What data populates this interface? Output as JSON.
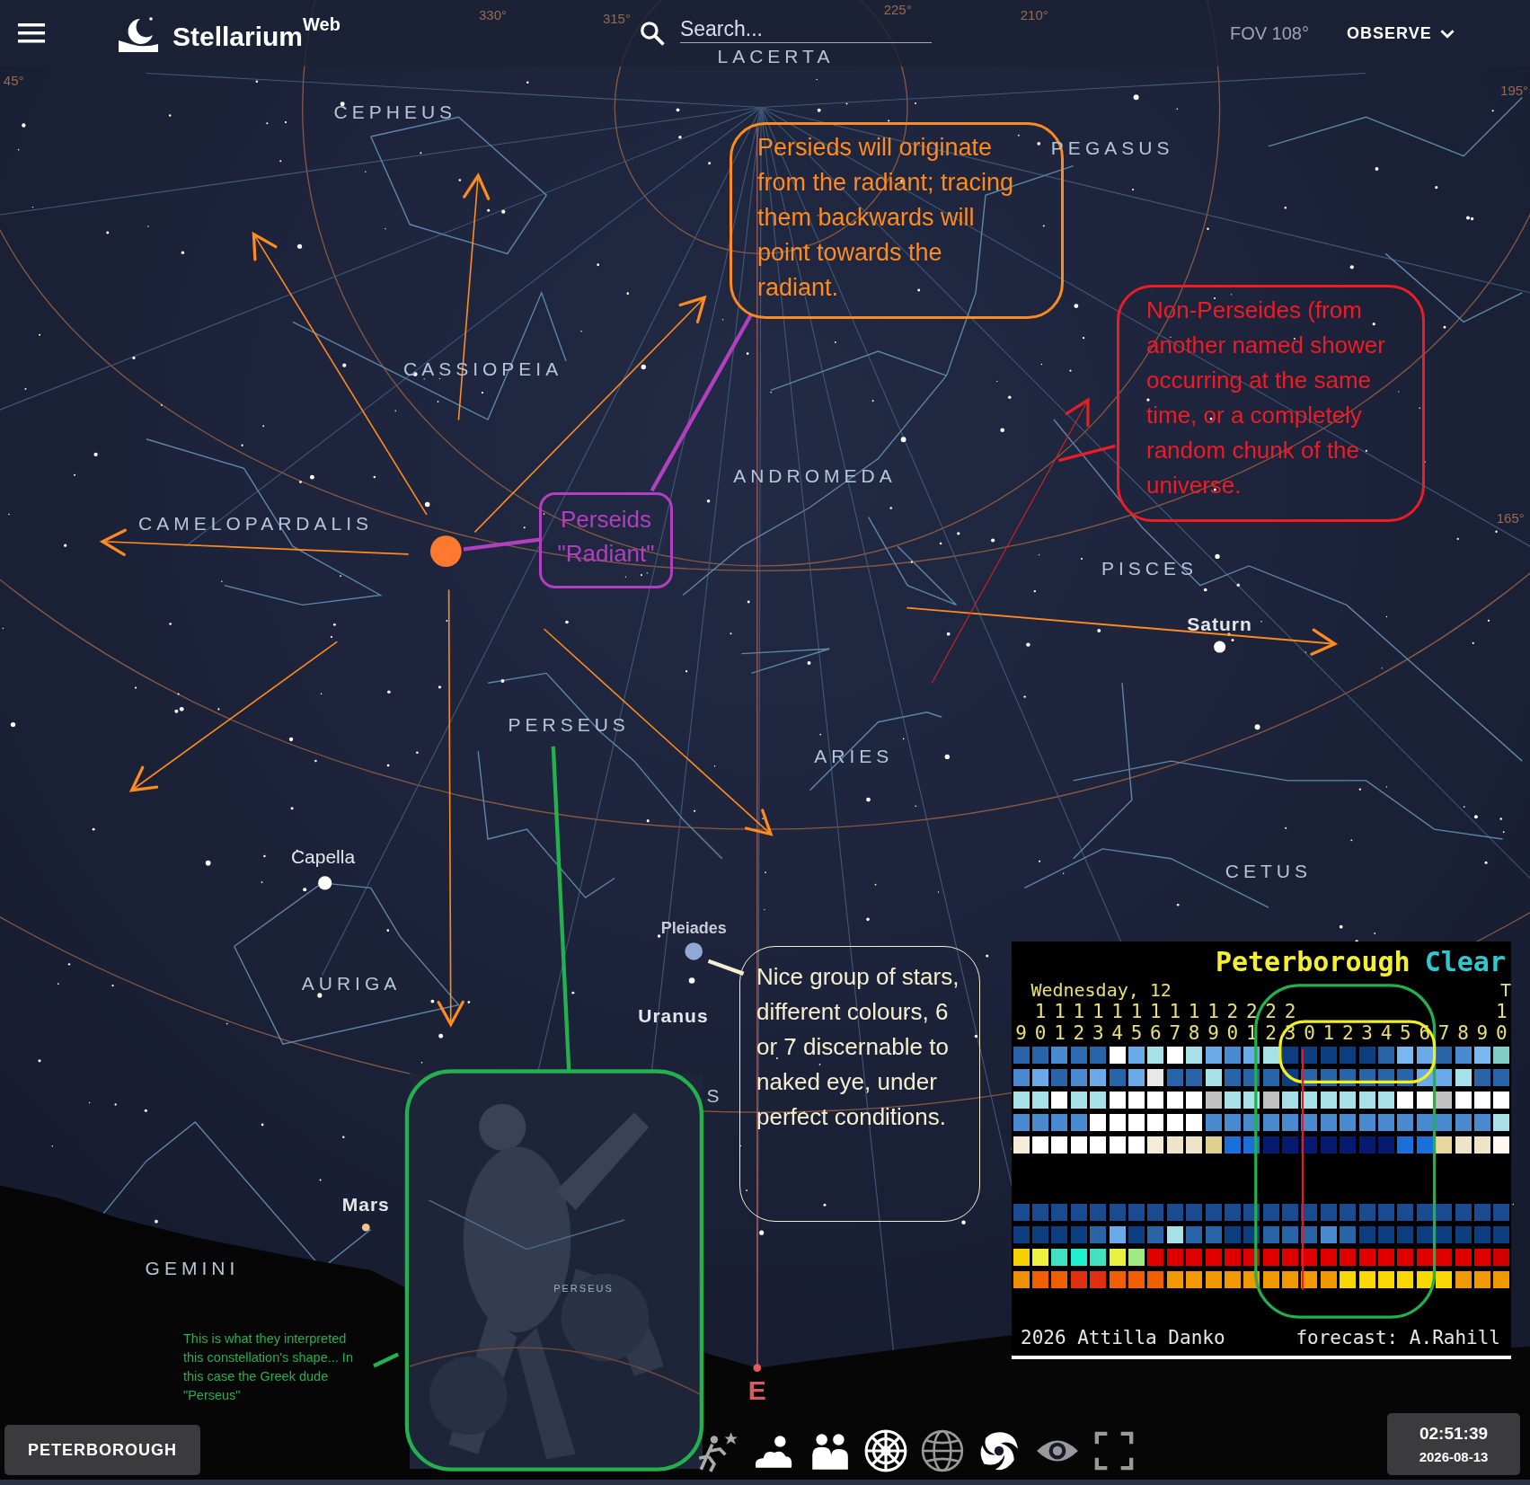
{
  "top_bar": {
    "title": "Stellarium",
    "title_suffix": "Web",
    "search": {
      "placeholder": "Search..."
    },
    "fov": "FOV 108°",
    "observe_menu": "OBSERVE"
  },
  "sky_labels": [
    {
      "text": "LACERTA",
      "kind": "constellation"
    },
    {
      "text": "CEPHEUS",
      "kind": "constellation"
    },
    {
      "text": "PEGASUS",
      "kind": "constellation"
    },
    {
      "text": "CASSIOPEIA",
      "kind": "constellation"
    },
    {
      "text": "ANDROMEDA",
      "kind": "constellation"
    },
    {
      "text": "CAMELOPARDALIS",
      "kind": "constellation"
    },
    {
      "text": "PISCES",
      "kind": "constellation"
    },
    {
      "text": "Saturn",
      "kind": "planet"
    },
    {
      "text": "PERSEUS",
      "kind": "constellation"
    },
    {
      "text": "ARIES",
      "kind": "constellation"
    },
    {
      "text": "Capella",
      "kind": "star"
    },
    {
      "text": "CETUS",
      "kind": "constellation"
    },
    {
      "text": "Pleiades",
      "kind": "cluster"
    },
    {
      "text": "AURIGA",
      "kind": "constellation"
    },
    {
      "text": "Uranus",
      "kind": "planet"
    },
    {
      "text": "S",
      "kind": "constellation"
    },
    {
      "text": "Mars",
      "kind": "planet"
    },
    {
      "text": "GEMINI",
      "kind": "constellation"
    },
    {
      "text": "PERSEUS",
      "kind": "art"
    },
    {
      "text": "E",
      "kind": "cardinal"
    },
    {
      "text": "330°",
      "kind": "grid"
    },
    {
      "text": "315°",
      "kind": "grid"
    },
    {
      "text": "225°",
      "kind": "grid"
    },
    {
      "text": "210°",
      "kind": "grid"
    },
    {
      "text": "45°",
      "kind": "grid"
    },
    {
      "text": "195°",
      "kind": "grid"
    },
    {
      "text": "165°",
      "kind": "grid"
    }
  ],
  "annotations": [
    {
      "kind": "box",
      "color": "#ff8a1e",
      "text": "Persieds will originate from the radiant; tracing them backwards will point towards the radiant."
    },
    {
      "kind": "box",
      "color": "#b13fc0",
      "text": "Perseids \"Radiant\""
    },
    {
      "kind": "box",
      "color": "#ee1c24",
      "text": "Non-Perseides (from another named shower occurring at the same time, or a completely random chunk of the universe."
    },
    {
      "kind": "box",
      "color": "#f5efd0",
      "text": "Nice group of stars, different colours, 6 or 7 discernable to naked eye, under perfect conditions."
    },
    {
      "kind": "note",
      "color": "#22b14c",
      "text": "This is what they interpreted this constellation's shape... In this case the Greek dude \"Perseus\""
    }
  ],
  "clear_sky_chart": {
    "location": "Peterborough",
    "condition": "Clear",
    "day": "Wednesday, 12",
    "next_day": "T",
    "hours": [
      {
        "ones": "9"
      },
      {
        "tens": "1",
        "ones": "0"
      },
      {
        "tens": "1",
        "ones": "1"
      },
      {
        "tens": "1",
        "ones": "2"
      },
      {
        "tens": "1",
        "ones": "3"
      },
      {
        "tens": "1",
        "ones": "4"
      },
      {
        "tens": "1",
        "ones": "5"
      },
      {
        "tens": "1",
        "ones": "6"
      },
      {
        "tens": "1",
        "ones": "7"
      },
      {
        "tens": "1",
        "ones": "8"
      },
      {
        "tens": "1",
        "ones": "9"
      },
      {
        "tens": "2",
        "ones": "0"
      },
      {
        "tens": "2",
        "ones": "1"
      },
      {
        "tens": "2",
        "ones": "2"
      },
      {
        "tens": "2",
        "ones": "3"
      },
      {
        "ones": "0"
      },
      {
        "ones": "1"
      },
      {
        "ones": "2"
      },
      {
        "ones": "3"
      },
      {
        "ones": "4"
      },
      {
        "ones": "5"
      },
      {
        "ones": "6"
      },
      {
        "ones": "7"
      },
      {
        "ones": "8"
      },
      {
        "ones": "9"
      },
      {
        "tens": "1",
        "ones": "0"
      }
    ],
    "upper_rows": [
      {
        "cells": [
          {
            "color": "#2a64a8"
          },
          {
            "color": "#2a64a8"
          },
          {
            "color": "#4a8ad0"
          },
          {
            "color": "#2e6ab0"
          },
          {
            "color": "#2a64a8"
          },
          {
            "color": "#ffffff"
          },
          {
            "color": "#6aaae8"
          },
          {
            "color": "#a8e0e8"
          },
          {
            "color": "#ffffff"
          },
          {
            "color": "#a8e0e8"
          },
          {
            "color": "#6aaae8"
          },
          {
            "color": "#4a8ad0"
          },
          {
            "color": "#6aaae8"
          },
          {
            "color": "#a8e0e8"
          },
          {
            "color": "#0d3f80"
          },
          {
            "color": "#0d3f80"
          },
          {
            "color": "#0d3f80"
          },
          {
            "color": "#0d3f80"
          },
          {
            "color": "#0d3f80"
          },
          {
            "color": "#2a64a8"
          },
          {
            "color": "#7ab8f0"
          },
          {
            "color": "#6aaae8"
          },
          {
            "color": "#2a64a8"
          },
          {
            "color": "#4a8ad0"
          },
          {
            "color": "#7ab8f0"
          },
          {
            "color": "#80d0c8"
          }
        ]
      },
      {
        "cells": [
          {
            "color": "#4a8ad0"
          },
          {
            "color": "#6aaae8"
          },
          {
            "color": "#2a64a8"
          },
          {
            "color": "#4a8ad0"
          },
          {
            "color": "#6aaae8"
          },
          {
            "color": "#2a64a8"
          },
          {
            "color": "#6aaae8"
          },
          {
            "color": "#e8e8e8"
          },
          {
            "color": "#2a64a8"
          },
          {
            "color": "#2a64a8"
          },
          {
            "color": "#a8e0e8"
          },
          {
            "color": "#2a64a8"
          },
          {
            "color": "#2a64a8"
          },
          {
            "color": "#2a64a8"
          },
          {
            "color": "#0d3f80"
          },
          {
            "color": "#2a64a8"
          },
          {
            "color": "#2a64a8"
          },
          {
            "color": "#2a64a8"
          },
          {
            "color": "#2a64a8"
          },
          {
            "color": "#2a64a8"
          },
          {
            "color": "#2a64a8"
          },
          {
            "color": "#6aaae8"
          },
          {
            "color": "#6aaae8"
          },
          {
            "color": "#a8e0e8"
          },
          {
            "color": "#2a64a8"
          },
          {
            "color": "#2a64a8"
          }
        ]
      },
      {
        "cells": [
          {
            "color": "#a8e0e8"
          },
          {
            "color": "#a8e0e8"
          },
          {
            "color": "#ffffff"
          },
          {
            "color": "#a8e0e8"
          },
          {
            "color": "#a8e0e8"
          },
          {
            "color": "#ffffff"
          },
          {
            "color": "#ffffff"
          },
          {
            "color": "#ffffff"
          },
          {
            "color": "#ffffff"
          },
          {
            "color": "#ffffff"
          },
          {
            "color": "#c0c0c0"
          },
          {
            "color": "#a8e0e8"
          },
          {
            "color": "#a8e0e8"
          },
          {
            "color": "#c0c0c0"
          },
          {
            "color": "#a8e0e8"
          },
          {
            "color": "#a8e0e8"
          },
          {
            "color": "#a8e0e8"
          },
          {
            "color": "#a8e0e8"
          },
          {
            "color": "#a8e0e8"
          },
          {
            "color": "#a8e0e8"
          },
          {
            "color": "#ffffff"
          },
          {
            "color": "#ffffff"
          },
          {
            "color": "#c0c0c0"
          },
          {
            "color": "#ffffff"
          },
          {
            "color": "#ffffff"
          },
          {
            "color": "#ffffff"
          }
        ]
      },
      {
        "cells": [
          {
            "color": "#4a8ad0"
          },
          {
            "color": "#4a8ad0"
          },
          {
            "color": "#4a8ad0"
          },
          {
            "color": "#4a8ad0"
          },
          {
            "color": "#ffffff"
          },
          {
            "color": "#ffffff"
          },
          {
            "color": "#ffffff"
          },
          {
            "color": "#ffffff"
          },
          {
            "color": "#ffffff"
          },
          {
            "color": "#ffffff"
          },
          {
            "color": "#4a8ad0"
          },
          {
            "color": "#4a8ad0"
          },
          {
            "color": "#4a8ad0"
          },
          {
            "color": "#4a8ad0"
          },
          {
            "color": "#4a8ad0"
          },
          {
            "color": "#4a8ad0"
          },
          {
            "color": "#4a8ad0"
          },
          {
            "color": "#4a8ad0"
          },
          {
            "color": "#4a8ad0"
          },
          {
            "color": "#4a8ad0"
          },
          {
            "color": "#4a8ad0"
          },
          {
            "color": "#4a8ad0"
          },
          {
            "color": "#4a8ad0"
          },
          {
            "color": "#4a8ad0"
          },
          {
            "color": "#4a8ad0"
          },
          {
            "color": "#a8e0e8"
          }
        ]
      },
      {
        "cells": [
          {
            "color": "#f5ecd8"
          },
          {
            "color": "#ffffff"
          },
          {
            "color": "#ffffff"
          },
          {
            "color": "#ffffff"
          },
          {
            "color": "#ffffff"
          },
          {
            "color": "#ffffff"
          },
          {
            "color": "#ffffff"
          },
          {
            "color": "#f5ecd8"
          },
          {
            "color": "#f0e4c8"
          },
          {
            "color": "#f0e4c8"
          },
          {
            "color": "#e0d090"
          },
          {
            "color": "#1a70d8"
          },
          {
            "color": "#1a70d8"
          },
          {
            "color": "#061a70"
          },
          {
            "color": "#061a70"
          },
          {
            "color": "#061a70"
          },
          {
            "color": "#061a70"
          },
          {
            "color": "#061a70"
          },
          {
            "color": "#061a70"
          },
          {
            "color": "#061a70"
          },
          {
            "color": "#1a70d8"
          },
          {
            "color": "#1a70d8"
          },
          {
            "color": "#e8d8a0"
          },
          {
            "color": "#f0e4c8"
          },
          {
            "color": "#f0e4c8"
          },
          {
            "color": "#fff8f0"
          }
        ]
      }
    ],
    "lower_rows": [
      {
        "cells": [
          {
            "color": "#1a4a90"
          },
          {
            "color": "#1a4a90"
          },
          {
            "color": "#1a4a90"
          },
          {
            "color": "#1a4a90"
          },
          {
            "color": "#1a4a90"
          },
          {
            "color": "#1a4a90"
          },
          {
            "color": "#1a4a90"
          },
          {
            "color": "#1a4a90"
          },
          {
            "color": "#1a4a90"
          },
          {
            "color": "#1a4a90"
          },
          {
            "color": "#1a4a90"
          },
          {
            "color": "#1a4a90"
          },
          {
            "color": "#1a4a90"
          },
          {
            "color": "#1a4a90"
          },
          {
            "color": "#1a4a90"
          },
          {
            "color": "#1a4a90"
          },
          {
            "color": "#1a4a90"
          },
          {
            "color": "#1a4a90"
          },
          {
            "color": "#1a4a90"
          },
          {
            "color": "#1a4a90"
          },
          {
            "color": "#1a4a90"
          },
          {
            "color": "#1a4a90"
          },
          {
            "color": "#1a4a90"
          },
          {
            "color": "#1a4a90"
          },
          {
            "color": "#1a4a90"
          },
          {
            "color": "#1a4a90"
          }
        ]
      },
      {
        "cells": [
          {
            "color": "#0d3f80"
          },
          {
            "color": "#0d3f80"
          },
          {
            "color": "#0d3f80"
          },
          {
            "color": "#0d3f80"
          },
          {
            "color": "#2a64a8"
          },
          {
            "color": "#6aaae8"
          },
          {
            "color": "#0d3f80"
          },
          {
            "color": "#2a64a8"
          },
          {
            "color": "#a8e0e8"
          },
          {
            "color": "#2a64a8"
          },
          {
            "color": "#2a64a8"
          },
          {
            "color": "#0d3f80"
          },
          {
            "color": "#0d3f80"
          },
          {
            "color": "#2a64a8"
          },
          {
            "color": "#2a64a8"
          },
          {
            "color": "#2a64a8"
          },
          {
            "color": "#4a8ad0"
          },
          {
            "color": "#2a64a8"
          },
          {
            "color": "#0d3f80"
          },
          {
            "color": "#0d3f80"
          },
          {
            "color": "#0d3f80"
          },
          {
            "color": "#0d3f80"
          },
          {
            "color": "#0d3f80"
          },
          {
            "color": "#0d3f80"
          },
          {
            "color": "#0d3f80"
          },
          {
            "color": "#0d3f80"
          }
        ]
      },
      {
        "cells": [
          {
            "color": "#f8d000"
          },
          {
            "color": "#f0f040"
          },
          {
            "color": "#40e0c0"
          },
          {
            "color": "#20f0d0"
          },
          {
            "color": "#40e0c0"
          },
          {
            "color": "#e8f040"
          },
          {
            "color": "#a0e880"
          },
          {
            "color": "#e00000"
          },
          {
            "color": "#e00000"
          },
          {
            "color": "#e00000"
          },
          {
            "color": "#e00000"
          },
          {
            "color": "#e00000"
          },
          {
            "color": "#e00000"
          },
          {
            "color": "#e00000"
          },
          {
            "color": "#e00000"
          },
          {
            "color": "#e00000"
          },
          {
            "color": "#e00000"
          },
          {
            "color": "#e00000"
          },
          {
            "color": "#e00000"
          },
          {
            "color": "#e00000"
          },
          {
            "color": "#e00000"
          },
          {
            "color": "#e00000"
          },
          {
            "color": "#e00000"
          },
          {
            "color": "#e00000"
          },
          {
            "color": "#e00000"
          },
          {
            "color": "#d00000"
          }
        ]
      },
      {
        "cells": [
          {
            "color": "#f09000"
          },
          {
            "color": "#f06000"
          },
          {
            "color": "#f06000"
          },
          {
            "color": "#e03010"
          },
          {
            "color": "#e03010"
          },
          {
            "color": "#f06000"
          },
          {
            "color": "#f06000"
          },
          {
            "color": "#f06000"
          },
          {
            "color": "#f09a00"
          },
          {
            "color": "#f09a00"
          },
          {
            "color": "#f09a00"
          },
          {
            "color": "#f09a00"
          },
          {
            "color": "#f09a00"
          },
          {
            "color": "#f09a00"
          },
          {
            "color": "#f09a00"
          },
          {
            "color": "#f09a00"
          },
          {
            "color": "#f09a00"
          },
          {
            "color": "#f8d800"
          },
          {
            "color": "#f8d800"
          },
          {
            "color": "#f8d800"
          },
          {
            "color": "#f8d800"
          },
          {
            "color": "#f8d800"
          },
          {
            "color": "#f8d800"
          },
          {
            "color": "#f09a00"
          },
          {
            "color": "#f09a00"
          },
          {
            "color": "#f09a00"
          }
        ]
      }
    ],
    "credit": "2026 Attilla Danko",
    "forecast": "forecast: A.Rahill"
  },
  "location_button": "PETERBOROUGH",
  "time": "02:51:39",
  "date": "2026-08-13"
}
